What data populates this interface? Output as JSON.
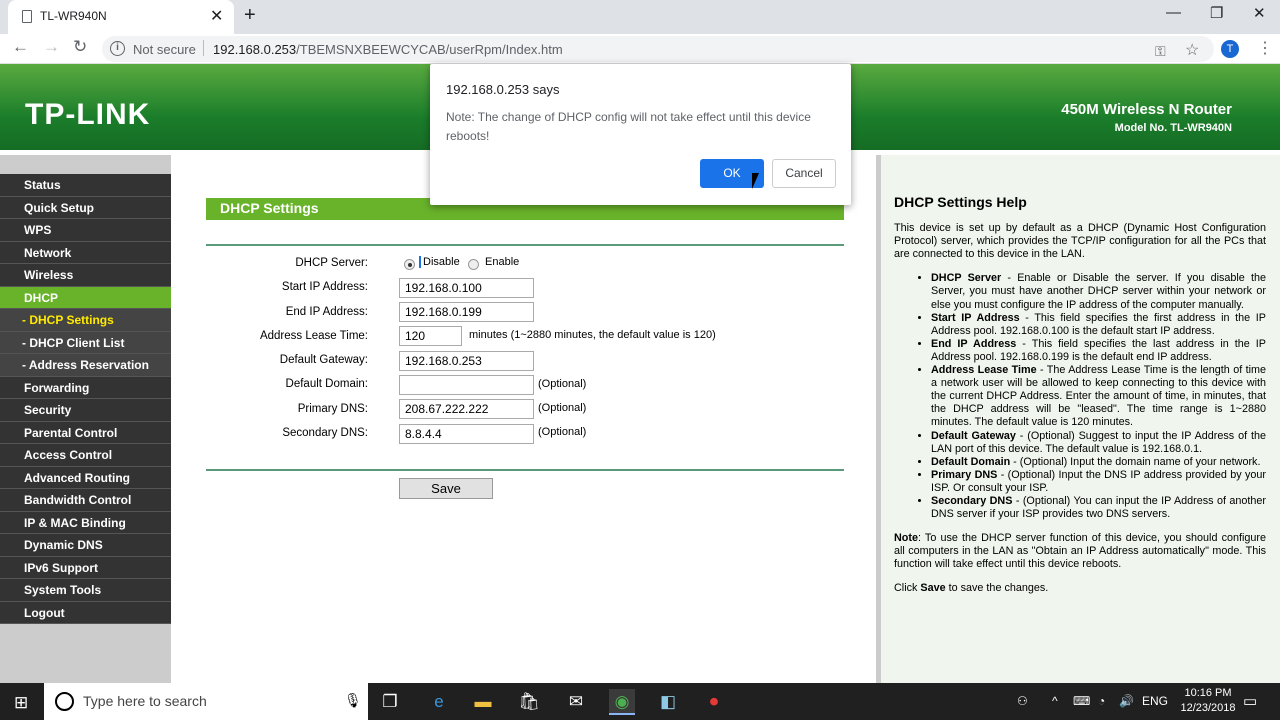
{
  "browser": {
    "tab_title": "TL-WR940N",
    "not_secure": "Not secure",
    "url_host": "192.168.0.253",
    "url_path": "/TBEMSNXBEEWCYCAB/userRpm/Index.htm",
    "avatar_letter": "T"
  },
  "header": {
    "logo": "TP-LINK",
    "product": "450M Wireless N Router",
    "model": "Model No. TL-WR940N"
  },
  "menu": [
    {
      "label": "Status",
      "type": "main"
    },
    {
      "label": "Quick Setup",
      "type": "main"
    },
    {
      "label": "WPS",
      "type": "main"
    },
    {
      "label": "Network",
      "type": "main"
    },
    {
      "label": "Wireless",
      "type": "main"
    },
    {
      "label": "DHCP",
      "type": "active"
    },
    {
      "label": "- DHCP Settings",
      "type": "subactive"
    },
    {
      "label": "- DHCP Client List",
      "type": "sub"
    },
    {
      "label": "- Address Reservation",
      "type": "sub"
    },
    {
      "label": "Forwarding",
      "type": "main"
    },
    {
      "label": "Security",
      "type": "main"
    },
    {
      "label": "Parental Control",
      "type": "main"
    },
    {
      "label": "Access Control",
      "type": "main"
    },
    {
      "label": "Advanced Routing",
      "type": "main"
    },
    {
      "label": "Bandwidth Control",
      "type": "main"
    },
    {
      "label": "IP & MAC Binding",
      "type": "main"
    },
    {
      "label": "Dynamic DNS",
      "type": "main"
    },
    {
      "label": "IPv6 Support",
      "type": "main"
    },
    {
      "label": "System Tools",
      "type": "main"
    },
    {
      "label": "Logout",
      "type": "main"
    }
  ],
  "form": {
    "title": "DHCP Settings",
    "dhcp_server_label": "DHCP Server:",
    "disable_label": "Disable",
    "enable_label": "Enable",
    "start_ip_label": "Start IP Address:",
    "start_ip": "192.168.0.100",
    "end_ip_label": "End IP Address:",
    "end_ip": "192.168.0.199",
    "lease_label": "Address Lease Time:",
    "lease": "120",
    "lease_note": "minutes (1~2880 minutes, the default value is 120)",
    "gateway_label": "Default Gateway:",
    "gateway": "192.168.0.253",
    "domain_label": "Default Domain:",
    "domain": "",
    "primary_dns_label": "Primary DNS:",
    "primary_dns": "208.67.222.222",
    "secondary_dns_label": "Secondary DNS:",
    "secondary_dns": "8.8.4.4",
    "optional": "(Optional)",
    "save": "Save"
  },
  "help": {
    "title": "DHCP Settings Help",
    "intro": "This device is set up by default as a DHCP (Dynamic Host Configuration Protocol) server, which provides the TCP/IP configuration for all the PCs that are connected to this device in the LAN.",
    "items": [
      {
        "term": "DHCP Server",
        "text": " - Enable or Disable the server. If you disable the Server, you must have another DHCP server within your network or else you must configure the IP address of the computer manually."
      },
      {
        "term": "Start IP Address",
        "text": " - This field specifies the first address in the IP Address pool. 192.168.0.100 is the default start IP address."
      },
      {
        "term": "End IP Address",
        "text": " - This field specifies the last address in the IP Address pool. 192.168.0.199 is the default end IP address."
      },
      {
        "term": "Address Lease Time",
        "text": " - The Address Lease Time is the length of time a network user will be allowed to keep connecting to this device with the current DHCP Address. Enter the amount of time, in minutes, that the DHCP address will be \"leased\". The time range is 1~2880 minutes. The default value is 120 minutes."
      },
      {
        "term": "Default Gateway",
        "text": " - (Optional) Suggest to input the IP Address of the LAN port of this device. The default value is 192.168.0.1."
      },
      {
        "term": "Default Domain",
        "text": " - (Optional) Input the domain name of your network."
      },
      {
        "term": "Primary DNS",
        "text": " - (Optional) Input the DNS IP address provided by your ISP. Or consult your ISP."
      },
      {
        "term": "Secondary DNS",
        "text": " - (Optional) You can input the IP Address of another DNS server if your ISP provides two DNS servers."
      }
    ],
    "note_label": "Note",
    "note_text": ": To use the DHCP server function of this device, you should configure all computers in the LAN as \"Obtain an IP Address automatically\" mode. This function will take effect until this device reboots.",
    "click": "Click ",
    "click_save": "Save",
    "click_rest": " to save the changes."
  },
  "dialog": {
    "title": "192.168.0.253 says",
    "message": "Note: The change of DHCP config will not take effect until this device reboots!",
    "ok": "OK",
    "cancel": "Cancel"
  },
  "taskbar": {
    "search_placeholder": "Type here to search",
    "lang": "ENG",
    "time": "10:16 PM",
    "date": "12/23/2018"
  }
}
